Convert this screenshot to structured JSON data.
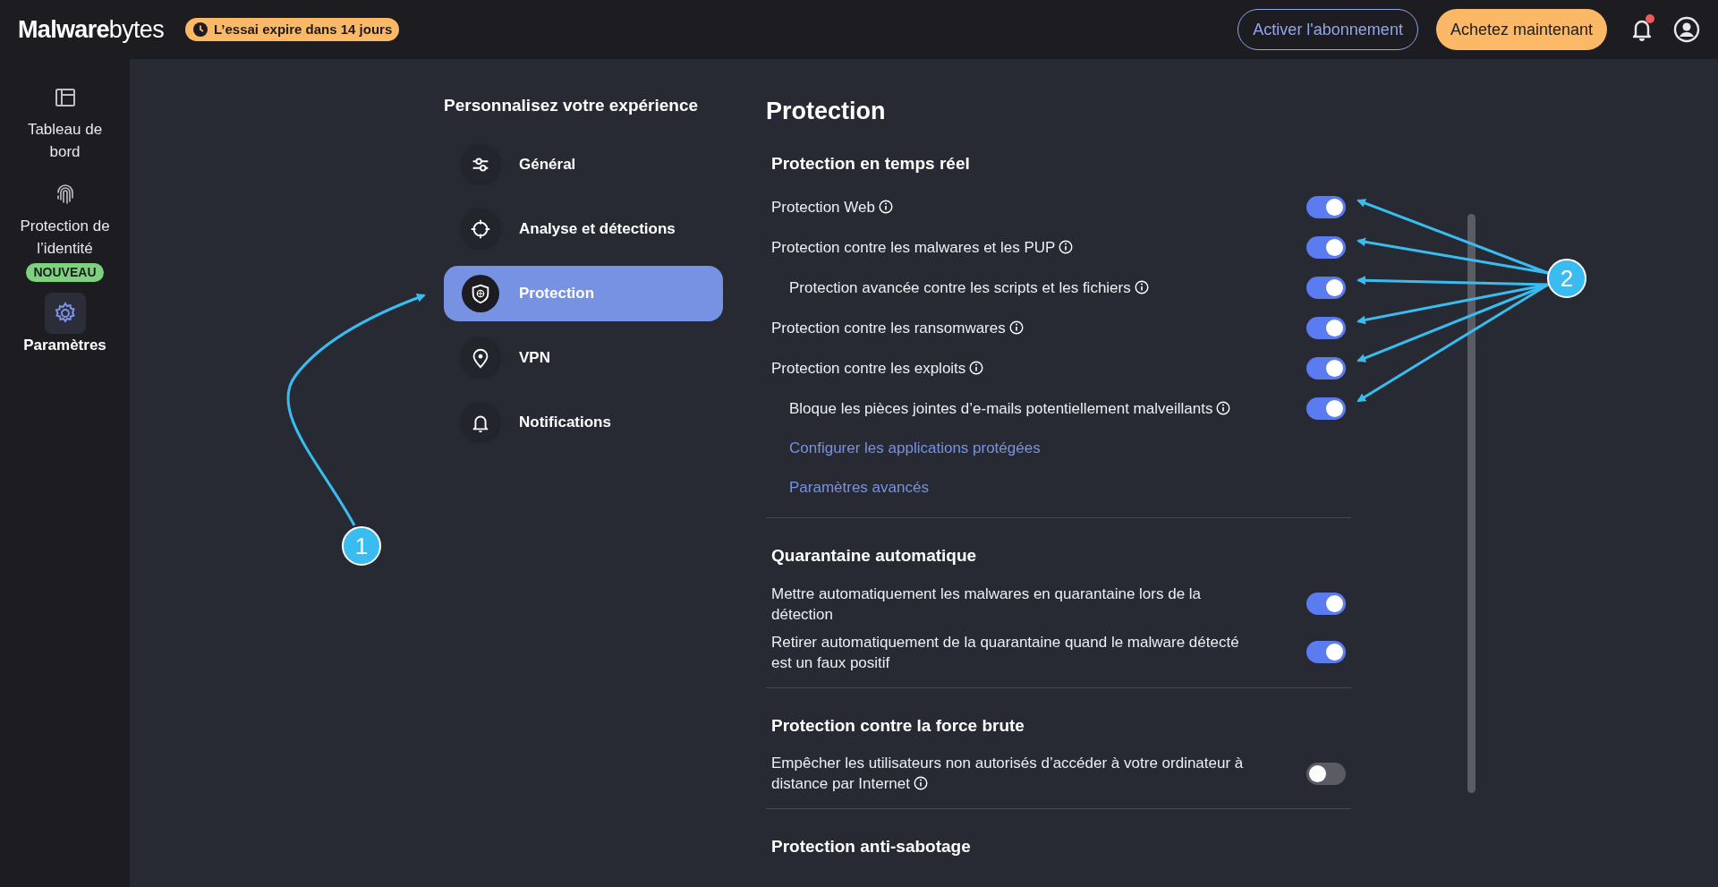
{
  "header": {
    "logo": {
      "bold": "Malware",
      "light": "bytes"
    },
    "trial_badge": "L’essai expire dans 14 jours",
    "buttons": [
      {
        "label": "Activer l'abonnement",
        "kind": "outline"
      },
      {
        "label": "Achetez maintenant",
        "kind": "primary"
      }
    ],
    "notification_dot": true
  },
  "sidebar": {
    "items": [
      {
        "label": "Tableau de bord",
        "selected": false
      },
      {
        "label": "Protection de l’identité",
        "selected": false,
        "badge": "NOUVEAU"
      },
      {
        "label": "Paramètres",
        "selected": true
      }
    ]
  },
  "settings_menu": {
    "heading": "Personnalisez votre expérience",
    "items": [
      {
        "label": "Général",
        "selected": false
      },
      {
        "label": "Analyse et détections",
        "selected": false
      },
      {
        "label": "Protection",
        "selected": true
      },
      {
        "label": "VPN",
        "selected": false
      },
      {
        "label": "Notifications",
        "selected": false
      }
    ]
  },
  "content": {
    "title": "Protection",
    "sections": [
      {
        "heading": "Protection en temps réel",
        "rows": [
          {
            "label": "Protection Web",
            "info": true,
            "on": true
          },
          {
            "label": "Protection contre les malwares et les PUP",
            "info": true,
            "on": true,
            "children": [
              {
                "label": "Protection avancée contre les scripts et les fichiers",
                "info": true,
                "on": true
              }
            ]
          },
          {
            "label": "Protection contre les ransomwares",
            "info": true,
            "on": true
          },
          {
            "label": "Protection contre les exploits",
            "info": true,
            "on": true,
            "children": [
              {
                "label": "Bloque les pièces jointes d’e-mails potentiellement malveillants",
                "info": true,
                "on": true
              }
            ]
          }
        ],
        "links": [
          "Configurer les applications protégées",
          "Paramètres avancés"
        ]
      },
      {
        "heading": "Quarantaine automatique",
        "rows": [
          {
            "label": "Mettre automatiquement les malwares en quarantaine lors de la détection",
            "info": false,
            "on": true
          },
          {
            "label": "Retirer automatiquement de la quarantaine quand le malware détecté est un faux positif",
            "info": false,
            "on": true
          }
        ]
      },
      {
        "heading": "Protection contre la force brute",
        "rows": [
          {
            "label": "Empêcher les utilisateurs non autorisés d’accéder à votre ordinateur à distance par Internet",
            "info": true,
            "on": false
          }
        ]
      },
      {
        "heading": "Protection anti-sabotage"
      }
    ]
  },
  "annotations": [
    {
      "label": "1"
    },
    {
      "label": "2"
    }
  ]
}
